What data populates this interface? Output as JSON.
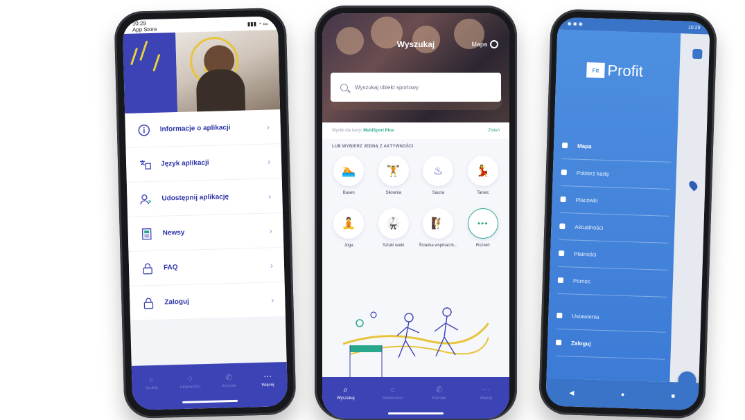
{
  "left_phone": {
    "status": {
      "time": "10:29",
      "carrier": "App Store"
    },
    "menu": [
      {
        "label": "Informacje o aplikacji",
        "icon": "info-icon"
      },
      {
        "label": "Język aplikacji",
        "icon": "language-icon"
      },
      {
        "label": "Udostępnij aplikację",
        "icon": "share-user-icon"
      },
      {
        "label": "Newsy",
        "icon": "news-icon"
      },
      {
        "label": "FAQ",
        "icon": "lock-icon"
      },
      {
        "label": "Zaloguj",
        "icon": "lock-icon"
      }
    ],
    "nav": [
      "Szukaj",
      "Aktywności",
      "Kontakt",
      "Więcej"
    ]
  },
  "center_phone": {
    "title": "Wyszukaj",
    "map_label": "Mapa",
    "search_placeholder": "Wyszukaj obiekt sportowy",
    "filter": {
      "prefix": "Wyniki dla karty:",
      "card": "MultiSport Plus",
      "change": "Zmień"
    },
    "section_label": "LUB WYBIERZ JEDNĄ Z AKTYWNOŚCI",
    "categories": [
      {
        "label": "Basen",
        "icon": "swimming-icon"
      },
      {
        "label": "Siłownia",
        "icon": "gym-icon"
      },
      {
        "label": "Sauna",
        "icon": "sauna-icon"
      },
      {
        "label": "Taniec",
        "icon": "dance-icon"
      },
      {
        "label": "Joga",
        "icon": "yoga-icon"
      },
      {
        "label": "Sztuki walki",
        "icon": "martial-arts-icon"
      },
      {
        "label": "Ścianka wspinaczk...",
        "icon": "climbing-icon"
      },
      {
        "label": "Rozwiń",
        "icon": "more-dots-icon"
      }
    ],
    "nav": [
      "Wyszukaj",
      "Aktywności",
      "Kontakt",
      "Więcej"
    ]
  },
  "right_phone": {
    "status": {
      "time": "10:29"
    },
    "logo": {
      "badge": "Fit",
      "name": "Profit"
    },
    "menu": [
      {
        "label": "Mapa"
      },
      {
        "label": "Pobierz kartę"
      },
      {
        "label": "Placówki"
      },
      {
        "label": "Aktualności"
      },
      {
        "label": "Płatności"
      },
      {
        "label": "Pomoc"
      },
      {
        "label": "Ustawienia"
      },
      {
        "label": "Zaloguj"
      }
    ],
    "nav": [
      "◀",
      "●",
      "■"
    ]
  },
  "colors": {
    "brand_blue": "#3c43b5",
    "accent_green": "#2aa88c",
    "drawer_blue": "#4d8fe0"
  }
}
